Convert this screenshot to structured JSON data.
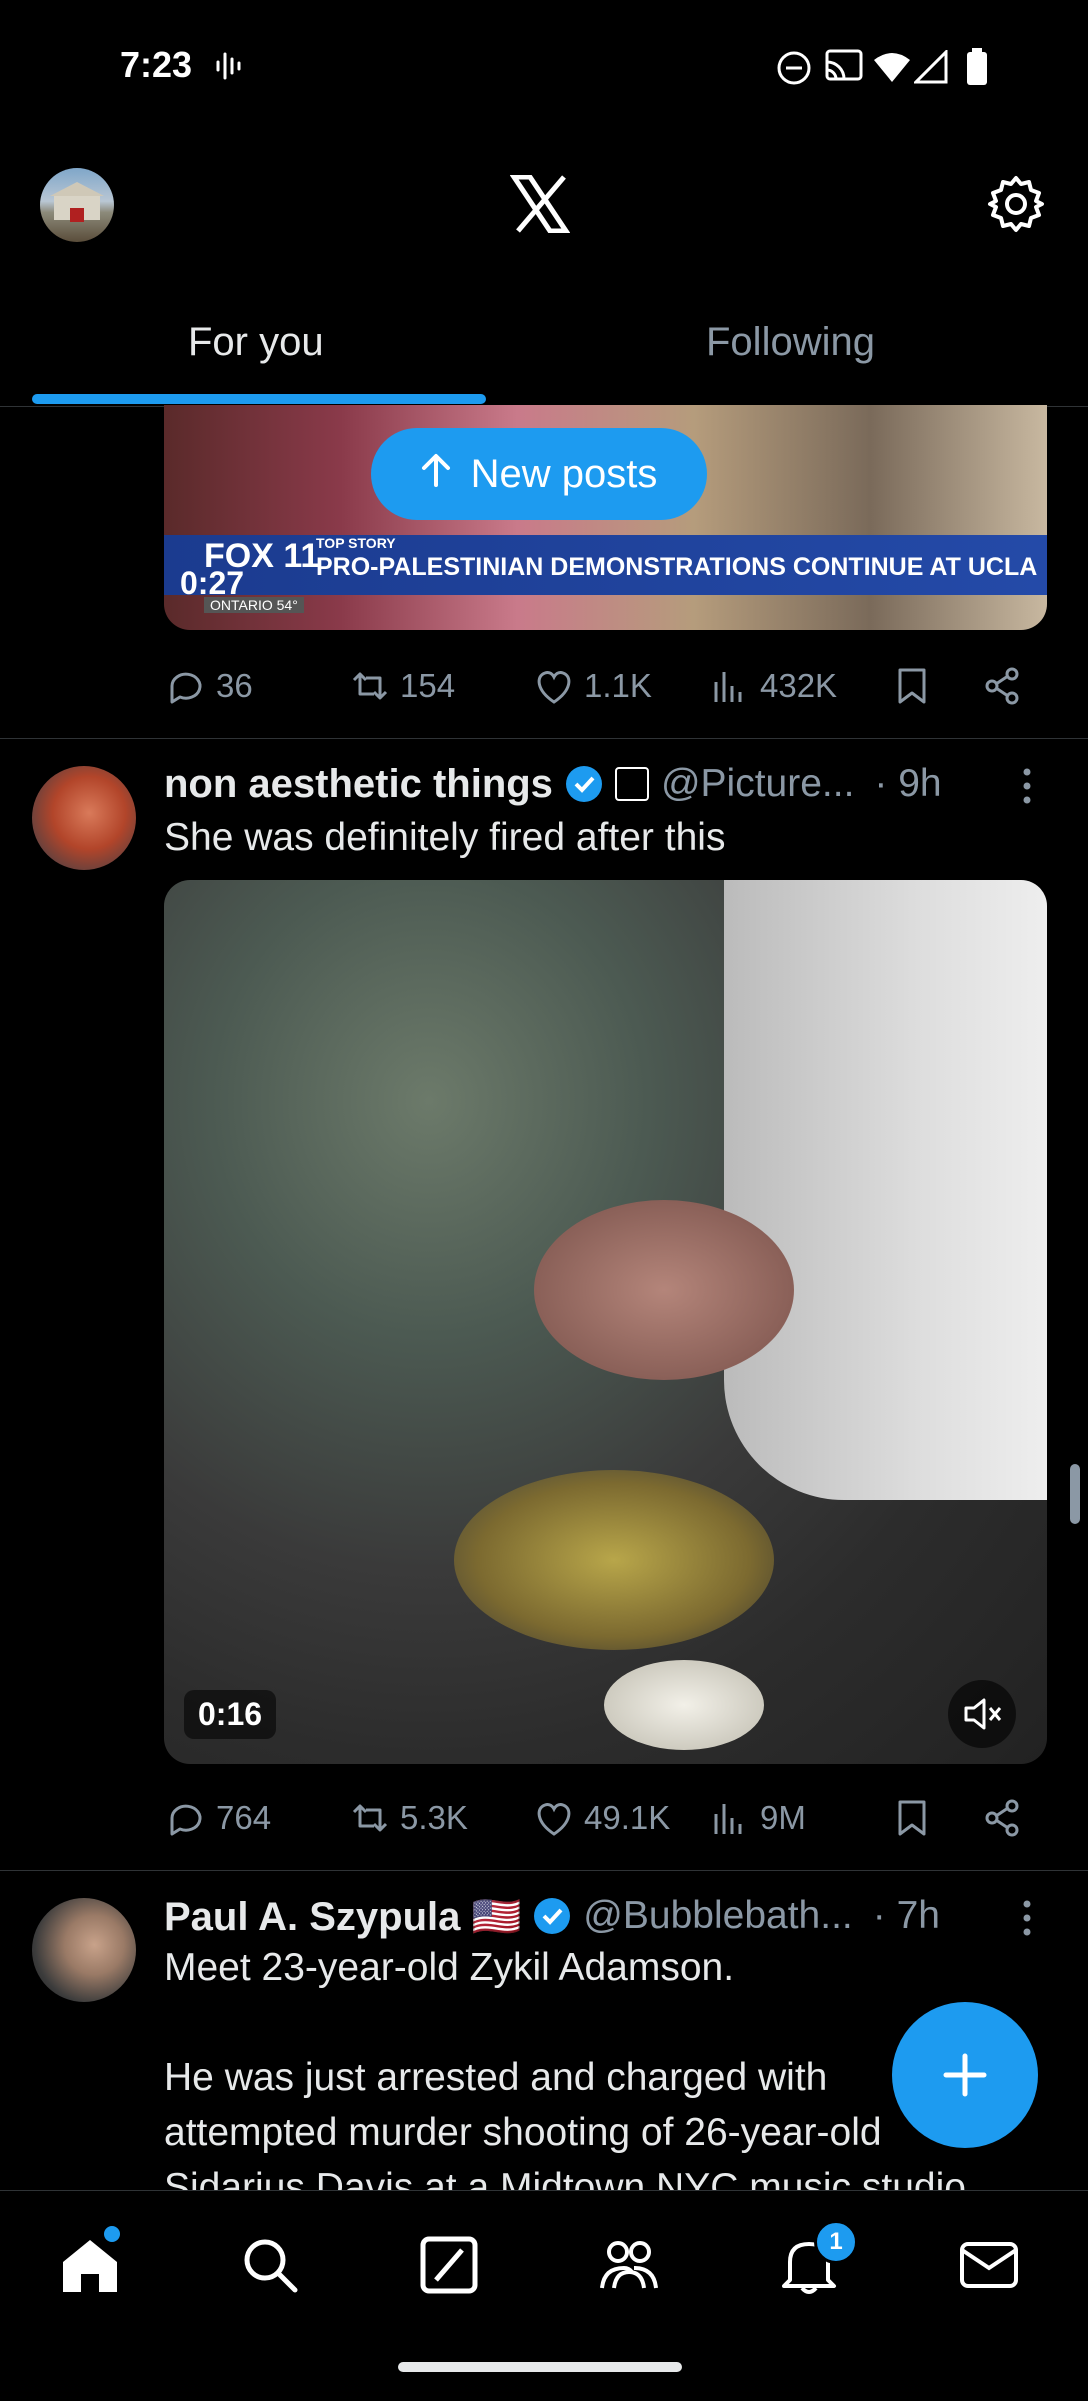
{
  "status_bar": {
    "time": "7:23"
  },
  "header": {
    "logo": "X",
    "settings_icon": "gear-icon",
    "avatar": "profile-avatar"
  },
  "tabs": [
    {
      "label": "For you",
      "active": true
    },
    {
      "label": "Following",
      "active": false
    }
  ],
  "new_posts_pill": {
    "label": "New posts"
  },
  "post1": {
    "video_duration": "0:27",
    "news_banner_tag": "TOP STORY",
    "news_banner": "PRO-PALESTINIAN DEMONSTRATIONS CONTINUE AT UCLA",
    "channel_logo": "FOX 11",
    "channel_sub": "ONTARIO",
    "channel_temp": "54°",
    "stats": {
      "replies": "36",
      "reposts": "154",
      "likes": "1.1K",
      "views": "432K"
    }
  },
  "post2": {
    "display_name": "non aesthetic things",
    "handle": "@Picture...",
    "time": "· 9h",
    "text": "She was definitely fired after this",
    "video_duration": "0:16",
    "stats": {
      "replies": "764",
      "reposts": "5.3K",
      "likes": "49.1K",
      "views": "9M"
    }
  },
  "post3": {
    "display_name": "Paul A. Szypula 🇺🇸",
    "handle": "@Bubblebath...",
    "time": "· 7h",
    "line1": "Meet 23-year-old Zykil Adamson.",
    "line2": "He was just arrested and charged with",
    "line3": "attempted murder shooting of 26-year-old",
    "line4": "Sidarius Davis at a Midtown NYC music studio"
  },
  "nav": {
    "notifications_badge": "1"
  },
  "colors": {
    "accent": "#1d9bf0",
    "background": "#000000",
    "secondary_text": "#8b98a5"
  }
}
